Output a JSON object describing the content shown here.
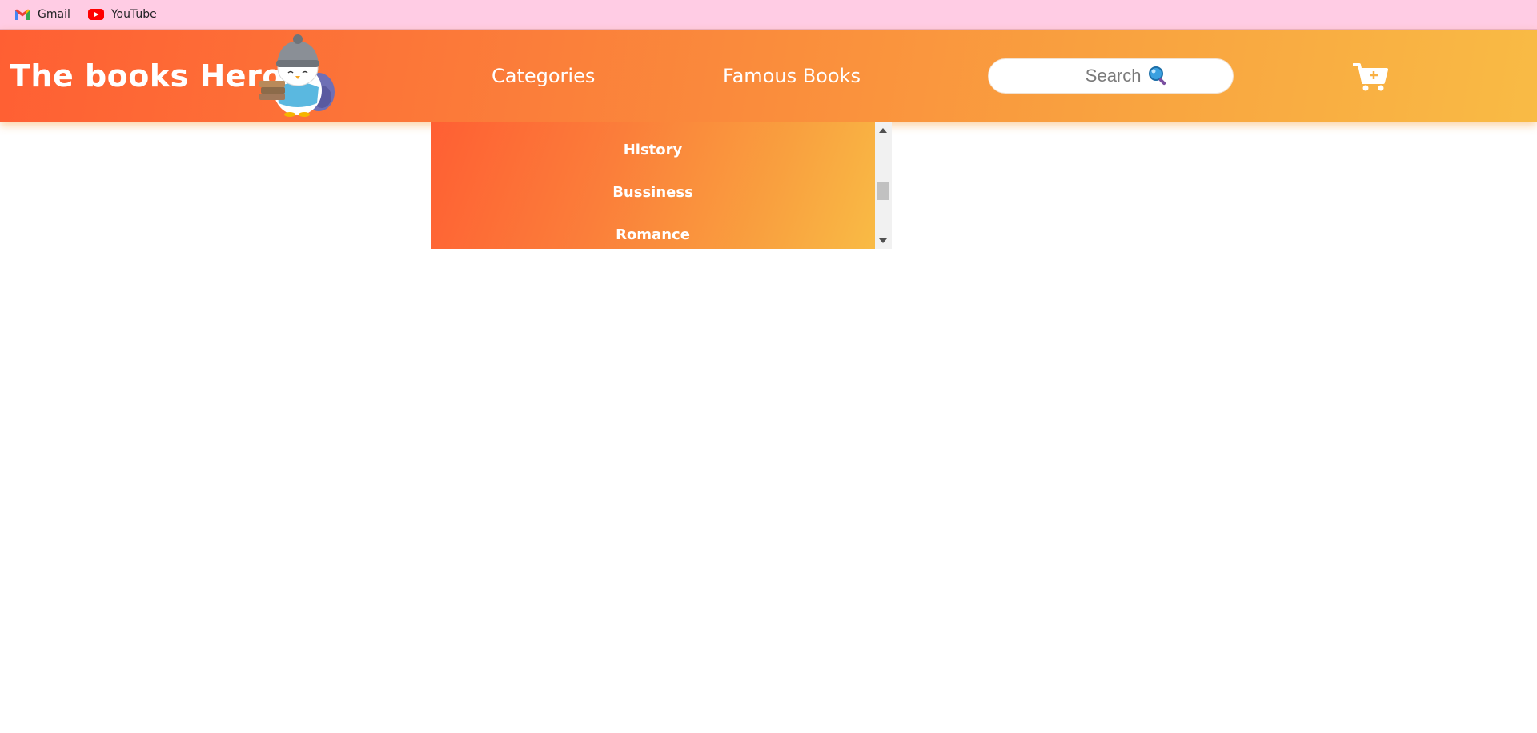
{
  "bookmarks": [
    {
      "label": "Gmail",
      "icon": "gmail-icon"
    },
    {
      "label": "YouTube",
      "icon": "youtube-icon"
    }
  ],
  "header": {
    "brand": "The books Hero",
    "mascot_icon": "penguin-reading-mascot",
    "nav": {
      "categories": "Categories",
      "famous_books": "Famous Books"
    },
    "search": {
      "placeholder": "Search",
      "icon": "magnifier-icon"
    },
    "cart_icon": "cart-plus-icon"
  },
  "dropdown": {
    "items": [
      "History",
      "Bussiness",
      "Romance"
    ]
  },
  "colors": {
    "bookmarks_bg": "#ffcce4",
    "gradient_start": "#ff5f33",
    "gradient_end": "#f9bb45",
    "text_light": "#ffffff"
  }
}
